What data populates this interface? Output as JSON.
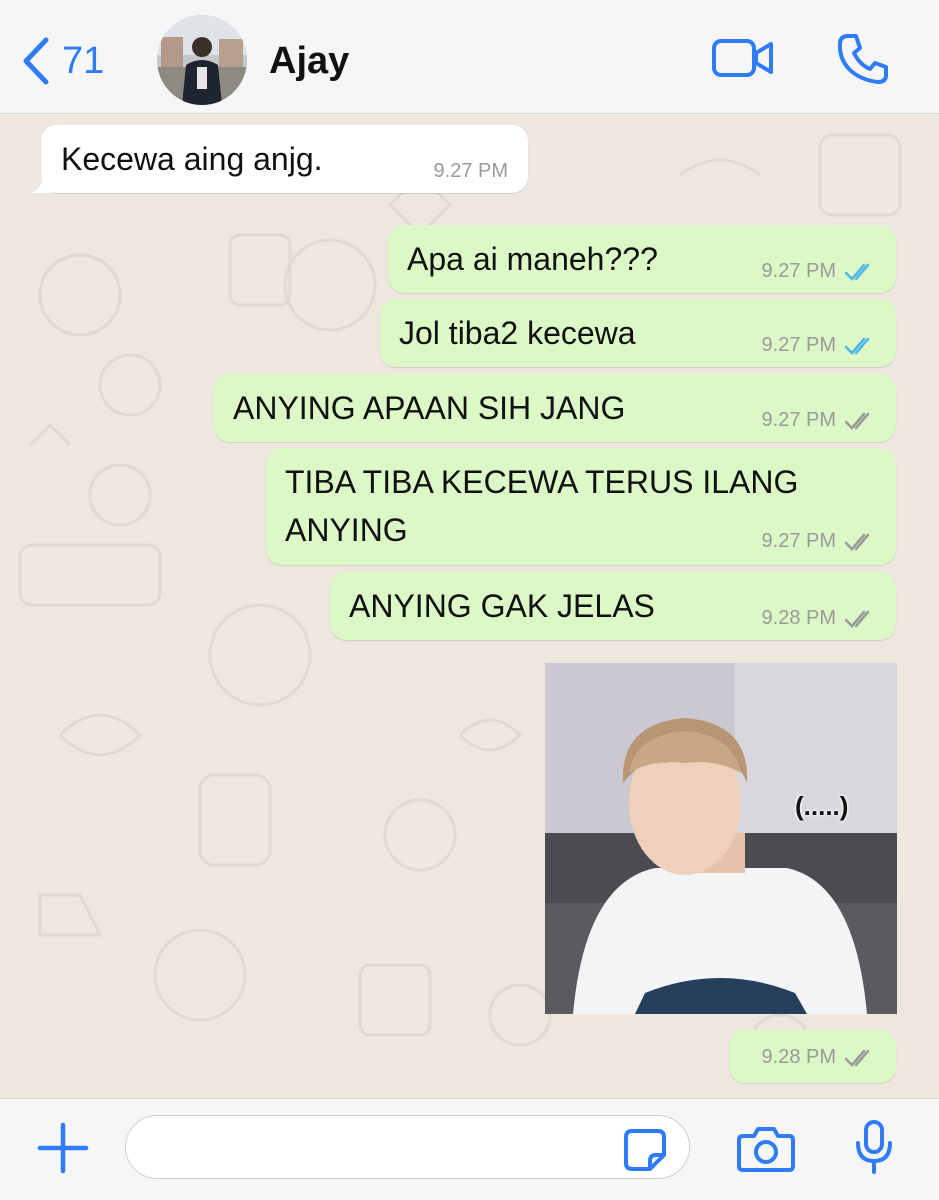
{
  "header": {
    "back_count": "71",
    "contact_name": "Ajay",
    "icons": [
      "chevron-left-icon",
      "video-camera-icon",
      "phone-icon"
    ]
  },
  "messages": [
    {
      "direction": "in",
      "text": "Kecewa aing anjg.",
      "time": "9.27 PM"
    },
    {
      "direction": "out",
      "text": "Apa ai maneh???",
      "time": "9.27 PM",
      "status": "read"
    },
    {
      "direction": "out",
      "text": "Jol tiba2 kecewa",
      "time": "9.27 PM",
      "status": "read"
    },
    {
      "direction": "out",
      "text": "ANYING APAAN SIH JANG",
      "time": "9.27 PM",
      "status": "delivered"
    },
    {
      "direction": "out",
      "text": "TIBA TIBA KECEWA TERUS ILANG\nANYING",
      "time": "9.27 PM",
      "status": "delivered"
    },
    {
      "direction": "out",
      "text": "ANYING GAK JELAS",
      "time": "9.28 PM",
      "status": "delivered"
    },
    {
      "direction": "out",
      "type": "image",
      "caption_overlay": "(.....)",
      "time": "9.28 PM",
      "status": "delivered"
    }
  ],
  "input": {
    "placeholder": "",
    "value": ""
  },
  "colors": {
    "accent": "#2f7cf6",
    "outgoing_bubble": "#dcf8c6",
    "incoming_bubble": "#ffffff",
    "read_ticks": "#4fb6ec",
    "delivered_ticks": "#9a9a9a",
    "chat_background": "#ede7df"
  }
}
